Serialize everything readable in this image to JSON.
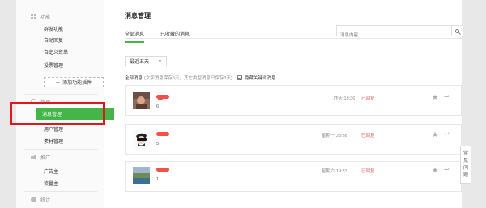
{
  "sidebar": {
    "sections": [
      {
        "title": "功能",
        "icon": "grid-icon",
        "items": [
          "群发功能",
          "自动回复",
          "自定义菜单",
          "投票管理"
        ]
      },
      {
        "title": "管理",
        "icon": "chat-icon",
        "items": [
          "消息管理",
          "用户管理",
          "素材管理"
        ]
      },
      {
        "title": "推广",
        "icon": "horn-icon",
        "items": [
          "广告主",
          "流量主"
        ]
      },
      {
        "title": "统计",
        "icon": "pie-icon",
        "items": []
      }
    ],
    "add_plugin_label": "添加功能插件",
    "active_item": "消息管理"
  },
  "main": {
    "title": "消息管理",
    "tabs": [
      {
        "label": "全部消息",
        "active": true
      },
      {
        "label": "已收藏的消息",
        "active": false
      }
    ],
    "search": {
      "placeholder": "消息内容"
    },
    "filter": {
      "selected": "最近五天"
    },
    "info": {
      "label": "全部消息",
      "note": "(文字消息保存5天，其它类型消息只保存3天)",
      "hide_keyword_label": "隐藏关键词消息",
      "hide_keyword_checked": true
    },
    "messages": [
      {
        "text": "6",
        "time": "昨天 13:36",
        "status": "已回复"
      },
      {
        "text": "5",
        "time": "星期一 23:38",
        "status": "已回复"
      },
      {
        "text": "1",
        "time": "星期六 19:33",
        "status": "已回复"
      }
    ]
  },
  "help": {
    "label_chars": [
      "常",
      "见",
      "问",
      "题"
    ]
  },
  "colors": {
    "accent": "#44b549",
    "highlight": "#e2161a",
    "status": "#e15f63"
  }
}
